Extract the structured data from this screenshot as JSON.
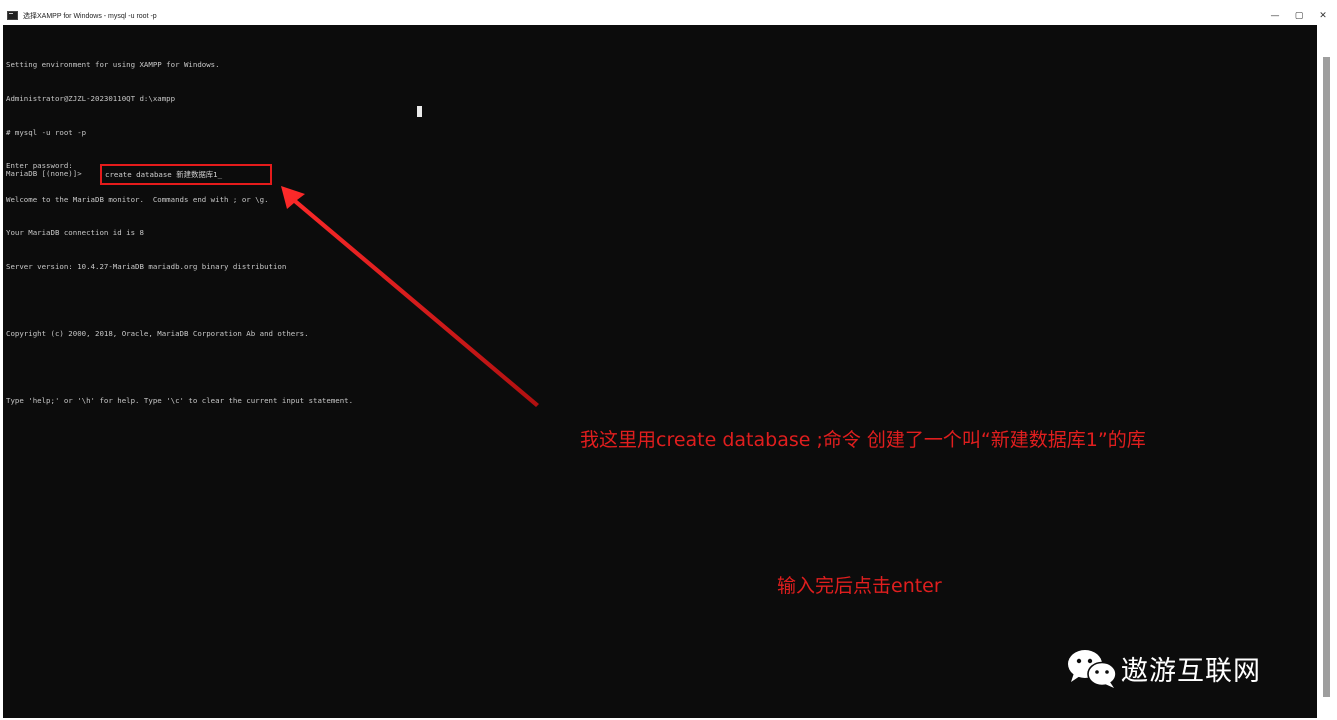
{
  "window": {
    "title": "选择XAMPP for Windows - mysql  -u root -p",
    "minimize_glyph": "—",
    "maximize_glyph": "▢",
    "close_glyph": "✕"
  },
  "terminal": {
    "lines": [
      "Setting environment for using XAMPP for Windows.",
      "Administrator@ZJZL-20230110QT d:\\xampp",
      "# mysql -u root -p",
      "Enter password:",
      "Welcome to the MariaDB monitor.  Commands end with ; or \\g.",
      "Your MariaDB connection id is 8",
      "Server version: 10.4.27-MariaDB mariadb.org binary distribution",
      "",
      "Copyright (c) 2000, 2018, Oracle, MariaDB Corporation Ab and others.",
      "",
      "Type 'help;' or '\\h' for help. Type '\\c' to clear the current input statement.",
      ""
    ],
    "prompt": "MariaDB [(none)]>",
    "command": "create database 新建数据库1_"
  },
  "annotations": {
    "explanation": "我这里用create database ;命令 创建了一个叫“新建数据库1”的库",
    "instruction": "输入完后点击enter"
  },
  "watermark": {
    "icon": "wechat-icon",
    "text": "遨游互联网"
  },
  "colors": {
    "terminal_bg": "#0c0c0c",
    "terminal_text": "#c8c8c8",
    "annotation_red": "#e01e1e",
    "titlebar_bg": "#ffffff"
  }
}
